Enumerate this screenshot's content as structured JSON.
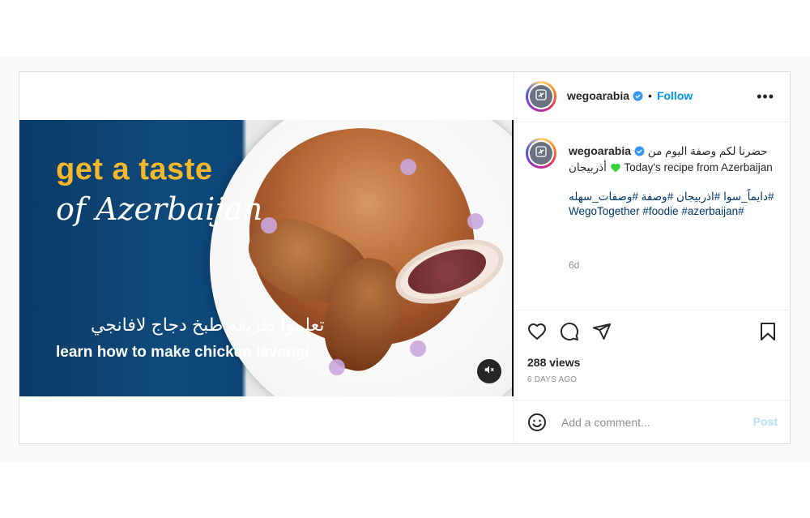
{
  "post": {
    "username": "wegoarabia",
    "follow_label": "Follow",
    "dot": "•",
    "more_label": "•••",
    "video": {
      "title_line1": "get a taste",
      "title_line2": "of Azerbaijan",
      "arabic_subtitle": "تعلموا طريقة طبخ دجاج لافانجي",
      "subtitle": "learn how to make chicken lavangi"
    },
    "caption": {
      "line_arabic": "حضرنا لكم وصفة اليوم من أذربيجان",
      "line_english": "Today's recipe from Azerbaijan",
      "hashtags": "#دايماً_سوا #اذربيجان #وصفة #وصفات_سهله #WegoTogether #foodie #azerbaijan",
      "age": "6d"
    },
    "views": "288 views",
    "timestamp": "6 DAYS AGO",
    "comment_placeholder": "Add a comment...",
    "post_label": "Post"
  },
  "colors": {
    "accent": "#0095f6",
    "hashtag": "#00376b",
    "video_title": "#f6b82a",
    "heart": "#3ad13a"
  },
  "icons": [
    "verified-badge-icon",
    "more-options-icon",
    "heart-icon",
    "comment-icon",
    "share-icon",
    "bookmark-icon",
    "emoji-icon",
    "mute-icon",
    "airplane-logo-icon"
  ]
}
